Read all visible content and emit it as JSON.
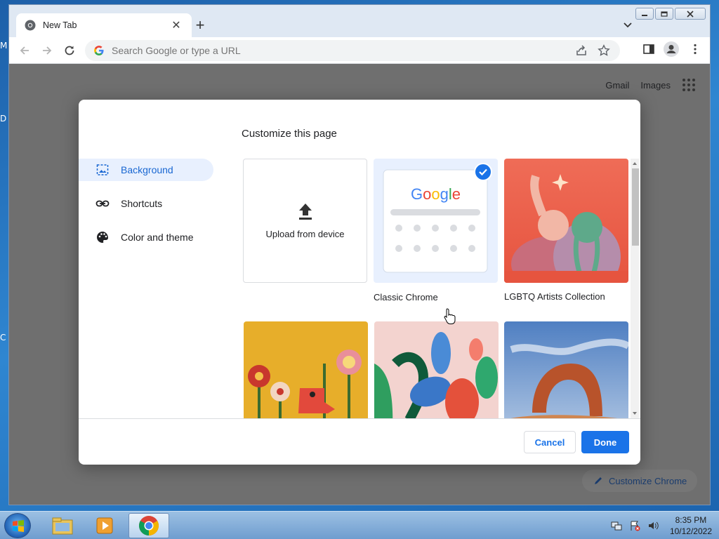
{
  "desktop": {
    "edge_letters": [
      "M",
      "D",
      "C"
    ]
  },
  "browser": {
    "tab": {
      "title": "New Tab"
    },
    "omnibox": {
      "placeholder": "Search Google or type a URL"
    }
  },
  "page": {
    "top_links": [
      "Gmail",
      "Images"
    ],
    "customize_chrome_label": "Customize Chrome"
  },
  "dialog": {
    "title": "Customize this page",
    "menu": [
      {
        "label": "Background",
        "icon": "image-icon",
        "active": true
      },
      {
        "label": "Shortcuts",
        "icon": "link-icon",
        "active": false
      },
      {
        "label": "Color and theme",
        "icon": "palette-icon",
        "active": false
      }
    ],
    "tiles": {
      "upload_label": "Upload from device",
      "classic_label": "Classic Chrome",
      "classic_logo": "Google",
      "lgbtq_label": "LGBTQ Artists Collection"
    },
    "buttons": {
      "cancel": "Cancel",
      "done": "Done"
    }
  },
  "taskbar": {
    "time": "8:35 PM",
    "date": "10/12/2022"
  },
  "colors": {
    "accent": "#1a73e8",
    "active_bg": "#e8f0fe"
  }
}
